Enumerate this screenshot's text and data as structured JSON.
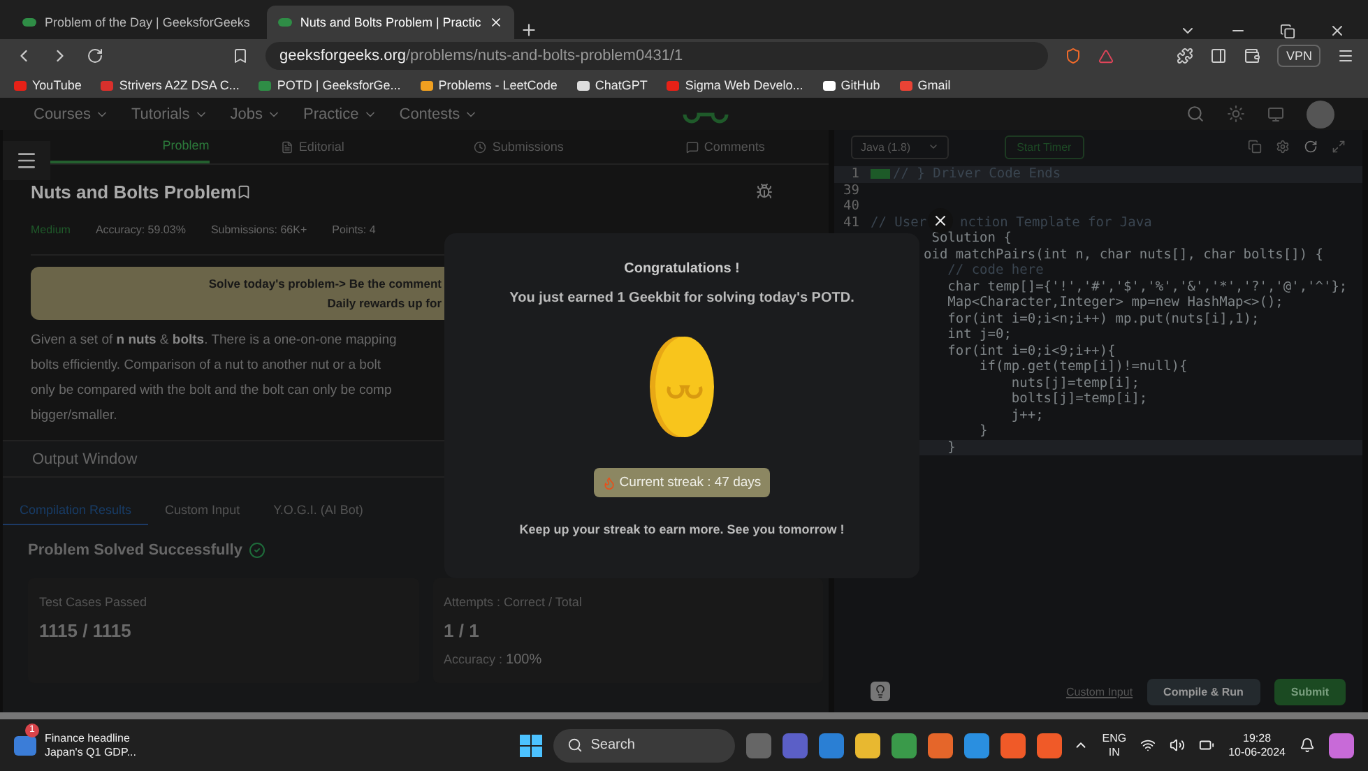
{
  "browser": {
    "tabs": [
      {
        "title": "Problem of the Day | GeeksforGeeks",
        "selected": false
      },
      {
        "title": "Nuts and Bolts Problem | Practic",
        "selected": true
      }
    ],
    "address": {
      "host": "geeksforgeeks.org",
      "path": "/problems/nuts-and-bolts-problem0431/1"
    },
    "vpn": "VPN",
    "bookmarks": [
      {
        "label": "YouTube",
        "color": "#e62117"
      },
      {
        "label": "Strivers A2Z DSA C...",
        "color": "#d9302c"
      },
      {
        "label": "POTD | GeeksforGe...",
        "color": "#2f8d46"
      },
      {
        "label": "Problems - LeetCode",
        "color": "#f0a020"
      },
      {
        "label": "ChatGPT",
        "color": "#dddddd"
      },
      {
        "label": "Sigma Web Develo...",
        "color": "#e62117"
      },
      {
        "label": "GitHub",
        "color": "#ffffff"
      },
      {
        "label": "Gmail",
        "color": "#ea4335"
      }
    ]
  },
  "site_nav": {
    "items": [
      "Courses",
      "Tutorials",
      "Jobs",
      "Practice",
      "Contests"
    ]
  },
  "problem_tabs": [
    {
      "label": "Problem",
      "selected": true
    },
    {
      "label": "Editorial",
      "selected": false
    },
    {
      "label": "Submissions",
      "selected": false
    },
    {
      "label": "Comments",
      "selected": false
    }
  ],
  "problem": {
    "title": "Nuts and Bolts Problem",
    "difficulty": "Medium",
    "accuracy": "Accuracy: 59.03%",
    "submissions": "Submissions: 66K+",
    "points": "Points: 4",
    "banner": [
      "Solve today's problem-> Be the comment",
      "Daily rewards up for"
    ],
    "description": [
      "Given a set of **n nuts** & **bolts**. There is a one-on-one mapping",
      "bolts efficiently. Comparison of a nut to another nut or a bolt",
      "only be compared with the bolt and the bolt can only be comp",
      "bigger/smaller."
    ]
  },
  "output_window": {
    "title": "Output Window",
    "tabs": [
      {
        "label": "Compilation Results",
        "selected": true
      },
      {
        "label": "Custom Input",
        "selected": false
      },
      {
        "label": "Y.O.G.I. (AI Bot)",
        "selected": false
      }
    ],
    "status": "Problem Solved Successfully",
    "test_cases": {
      "label": "Test Cases Passed",
      "value": "1115 / 1115"
    },
    "attempts": {
      "label": "Attempts : Correct / Total",
      "value": "1 / 1",
      "accuracy_label": "Accuracy : ",
      "accuracy_value": "100%"
    }
  },
  "editor": {
    "language": "Java (1.8)",
    "timer": "Start Timer",
    "lines": [
      {
        "number": "1",
        "text": "// } Driver Code Ends",
        "highlight": true
      },
      {
        "number": "39",
        "highlight": false
      },
      {
        "number": "40",
        "highlight": false
      },
      {
        "number": "41",
        "text": "// User",
        "tail": "nction Template for Java",
        "highlight": false
      },
      {
        "text": " Solution {",
        "highlight": false
      },
      {
        "text": "oid matchPairs(int n, char nuts[], char bolts[]) {",
        "highlight": false
      },
      {
        "text": "   // code here",
        "highlight": false
      },
      {
        "text": "   char temp[]={'!','#','$','%','&','*','?','@','^'};",
        "highlight": false
      },
      {
        "text": "   Map<Character,Integer> mp=new HashMap<>();",
        "highlight": false
      },
      {
        "text": "   for(int i=0;i<n;i++) mp.put(nuts[i],1);",
        "highlight": false
      },
      {
        "text": "   int j=0;",
        "highlight": false
      },
      {
        "text": "   for(int i=0;i<9;i++){",
        "highlight": false
      },
      {
        "text": "       if(mp.get(temp[i])!=null){",
        "highlight": false
      },
      {
        "text": "           nuts[j]=temp[i];",
        "highlight": false
      },
      {
        "text": "           bolts[j]=temp[i];",
        "highlight": false
      },
      {
        "text": "           j++;",
        "highlight": false
      },
      {
        "text": "       }",
        "highlight": false
      },
      {
        "text": "   }",
        "highlight": true
      }
    ],
    "custom_input": "Custom Input",
    "compile": "Compile & Run",
    "submit": "Submit"
  },
  "modal": {
    "title": "Congratulations !",
    "message": "You just earned 1 Geekbit for solving today's POTD.",
    "streak": "Current streak : 47 days",
    "footer": "Keep up your streak to earn more. See you tomorrow !"
  },
  "taskbar": {
    "news_badge": "1",
    "news_title": "Finance headline",
    "news_text": "Japan's Q1 GDP...",
    "search": "Search",
    "lang": "ENG",
    "region": "IN",
    "time": "19:28",
    "date": "10-06-2024"
  }
}
